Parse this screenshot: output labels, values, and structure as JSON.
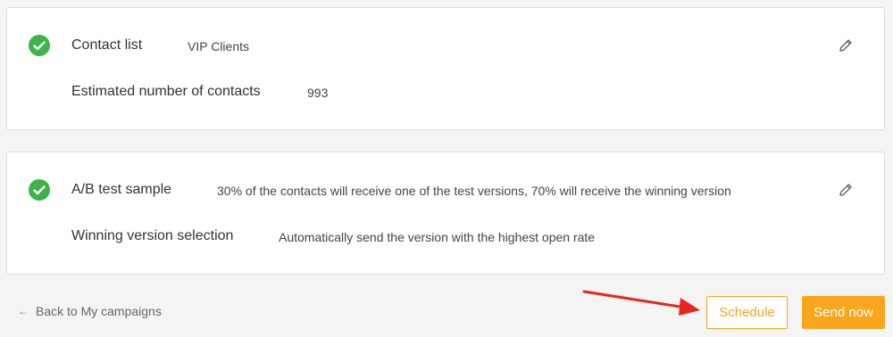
{
  "recipients_card": {
    "contact_list_label": "Contact list",
    "contact_list_value": "VIP Clients",
    "estimated_label": "Estimated number of contacts",
    "estimated_value": "993"
  },
  "ab_card": {
    "sample_label": "A/B test sample",
    "sample_value": "30% of the contacts will receive one of the test versions, 70% will receive the winning version",
    "winning_label": "Winning version selection",
    "winning_value": "Automatically send the version with the highest open rate"
  },
  "footer": {
    "back_arrow": "←",
    "back_label": "Back to My campaigns",
    "schedule_label": "Schedule",
    "send_now_label": "Send now"
  },
  "colors": {
    "accent": "#f9a61c",
    "success": "#3db349",
    "annotation_arrow": "#e8261c"
  },
  "icons": {
    "status": "check-circle-icon",
    "edit": "pencil-icon"
  }
}
